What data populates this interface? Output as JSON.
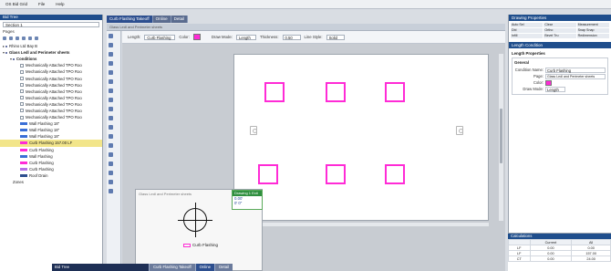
{
  "menubar": {
    "items": [
      "OS Bid Grid",
      "File",
      "Help"
    ]
  },
  "left_panel": {
    "title": "Bid Tree",
    "section_combo": "Section 1",
    "pages_label": "Pages",
    "tree": [
      {
        "level": 0,
        "toggle": "▸",
        "label": "Rhino Ltd Bay B",
        "kind": "dot"
      },
      {
        "level": 0,
        "toggle": "▾",
        "label": "Glass Ledl and Perimeter sheets",
        "kind": "dot",
        "bold": true
      },
      {
        "level": 1,
        "toggle": "▾",
        "label": "Conditions",
        "kind": "dot",
        "bold": true
      },
      {
        "level": 2,
        "toggle": "",
        "label": "Mechanically Attached TPO Roo",
        "kind": "check"
      },
      {
        "level": 2,
        "toggle": "",
        "label": "Mechanically Attached TPO Roo",
        "kind": "check"
      },
      {
        "level": 2,
        "toggle": "",
        "label": "Mechanically Attached TPO Roo",
        "kind": "check"
      },
      {
        "level": 2,
        "toggle": "",
        "label": "Mechanically Attached TPO Roo",
        "kind": "check"
      },
      {
        "level": 2,
        "toggle": "",
        "label": "Mechanically Attached TPO Roo",
        "kind": "check"
      },
      {
        "level": 2,
        "toggle": "",
        "label": "Mechanically Attached TPO Roo",
        "kind": "check"
      },
      {
        "level": 2,
        "toggle": "",
        "label": "Mechanically Attached TPO Roo",
        "kind": "check"
      },
      {
        "level": 2,
        "toggle": "",
        "label": "Mechanically Attached TPO Roo",
        "kind": "check"
      },
      {
        "level": 2,
        "toggle": "",
        "label": "Mechanically Attached TPO Roo",
        "kind": "check"
      },
      {
        "level": 2,
        "toggle": "",
        "label": "Wall Flashing 18\"",
        "kind": "swatch",
        "color": "#3b6fd6"
      },
      {
        "level": 2,
        "toggle": "",
        "label": "Wall Flashing 18\"",
        "kind": "swatch",
        "color": "#3b6fd6"
      },
      {
        "level": 2,
        "toggle": "",
        "label": "Wall Flashing 18\"",
        "kind": "swatch",
        "color": "#3b6fd6"
      },
      {
        "level": 2,
        "toggle": "",
        "label": "Curb Flashing      157.00 LF",
        "kind": "swatch",
        "color": "#ff2bd6",
        "selected": true
      },
      {
        "level": 2,
        "toggle": "",
        "label": "Curb Flashing",
        "kind": "swatch",
        "color": "#ff2bd6"
      },
      {
        "level": 2,
        "toggle": "",
        "label": "Wall Flashing",
        "kind": "swatch",
        "color": "#3b6fd6"
      },
      {
        "level": 2,
        "toggle": "",
        "label": "Curb Flashing",
        "kind": "swatch",
        "color": "#ff2bd6"
      },
      {
        "level": 2,
        "toggle": "",
        "label": "Curb Flashing",
        "kind": "swatch",
        "color": "#b56fe6"
      },
      {
        "level": 2,
        "toggle": "",
        "label": "Roof Drain",
        "kind": "swatch",
        "color": "#2d4f8f"
      },
      {
        "level": 1,
        "toggle": "",
        "label": "Zones",
        "kind": "none"
      }
    ]
  },
  "doc_tabs": [
    "Curb Flashing Takeoff",
    "Online",
    "Detail"
  ],
  "doc_strip": "Glass Ledl and Perimeter sheets",
  "propbar": {
    "length_label": "Length:",
    "length_value": "Curb Flashing",
    "color_label": "Color:",
    "draw_mode_label": "Draw Mode:",
    "draw_mode_value": "Length",
    "thickness_label": "Thickness:",
    "thickness_value": "0.50",
    "line_style_label": "Line Style:",
    "line_style_value": "Solid"
  },
  "canvas": {
    "preview_title": "Glass Ledl and Perimeter sheets",
    "preview_label": "Curb Flashing",
    "tooltip_title": "Drawing 1 Exit",
    "tooltip_lines": [
      "0.00'",
      "0' 0\""
    ]
  },
  "bottombar": {
    "combo": "Bid Tree",
    "tabs": [
      "Curb Flashing Takeoff",
      "Online",
      "Detail"
    ]
  },
  "right_panel": {
    "title": "Drawing Properties",
    "palette": [
      "Auto Sel",
      "Clear",
      "Measurement",
      "Dbl",
      "Ortho",
      "Snap Snap",
      "Infill",
      "Bevel Tru",
      "Redimension"
    ],
    "section_title": "Length Condition",
    "sub_title": "Length Properties",
    "group_label": "General",
    "rows": [
      {
        "k": "Condition Name:",
        "v": "Curb Flashing"
      },
      {
        "k": "Page:",
        "v": "Glass Ledl and Perimeter sheets"
      },
      {
        "k": "Color:",
        "v": ""
      },
      {
        "k": "Draw Mode:",
        "v": "Length"
      }
    ]
  },
  "calculations": {
    "title": "Calculations",
    "headers": [
      "",
      "Current",
      "All"
    ],
    "rows": [
      [
        "LF",
        "0.00",
        "0.00"
      ],
      [
        "LF",
        "0.00",
        "157.00"
      ],
      [
        "CT",
        "0.00",
        "24.00"
      ]
    ]
  },
  "colors": {
    "accent": "#1f4e8c",
    "condition": "#ff2bd6"
  }
}
